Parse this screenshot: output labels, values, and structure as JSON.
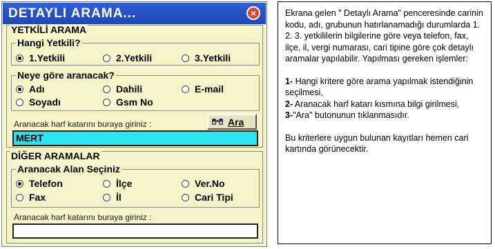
{
  "window": {
    "title": "DETAYLI ARAMA...",
    "close_label": "×"
  },
  "yetkili_section": {
    "title": "YETKİLİ ARAMA",
    "hangi_group": {
      "title": "Hangi Yetkili?",
      "options": [
        {
          "label": "1.Yetkili",
          "checked": true
        },
        {
          "label": "2.Yetkili",
          "checked": false
        },
        {
          "label": "3.Yetkili",
          "checked": false
        }
      ]
    },
    "neye_group": {
      "title": "Neye göre aranacak?",
      "options": [
        {
          "label": "Adı",
          "checked": true
        },
        {
          "label": "Dahili",
          "checked": false
        },
        {
          "label": "E-mail",
          "checked": false
        },
        {
          "label": "Soyadı",
          "checked": false
        },
        {
          "label": "Gsm No",
          "checked": false
        }
      ]
    },
    "search_label": "Aranacak harf katarını buraya giriniz :",
    "search_button": "Ara",
    "search_value": "MERT"
  },
  "diger_section": {
    "title": "DİĞER ARAMALAR",
    "alan_group": {
      "title": "Aranacak Alan Seçiniz",
      "options": [
        {
          "label": "Telefon",
          "checked": true
        },
        {
          "label": "İlçe",
          "checked": false
        },
        {
          "label": "Ver.No",
          "checked": false
        },
        {
          "label": "Fax",
          "checked": false
        },
        {
          "label": "İl",
          "checked": false
        },
        {
          "label": "Cari Tipi",
          "checked": false
        }
      ]
    },
    "search_label": "Aranacak harf katarını buraya giriniz :",
    "search_value": ""
  },
  "help_text": {
    "intro": "Ekrana gelen \" Detaylı Arama\" penceresinde carinin kodu, adı, grubunun hatırlanamadığı durumlarda 1. 2. 3. yetkililerin bilgilerine göre veya telefon, fax, ilçe, il, vergi numarası, cari tipine göre çok detaylı aramalar yapılabilir. Yapılması gereken işlemler:",
    "steps": [
      {
        "num": "1-",
        "text": " Hangi kritere göre arama yapılmak istendiğinin seçilmesi,"
      },
      {
        "num": "2-",
        "text": " Aranacak harf katarı kısmına bilgi girilmesi,"
      },
      {
        "num": "3-",
        "text": "\"Ara\" butonunun tıklanmasıdır."
      }
    ],
    "outro": "Bu kriterlere uygun bulunan kayıtları hemen cari kartında görünecektir."
  },
  "colors": {
    "title_bar": "#1f47b8",
    "panel": "#f5f3c8",
    "search_field": "#29e3f2",
    "close_button": "#d9462b"
  }
}
